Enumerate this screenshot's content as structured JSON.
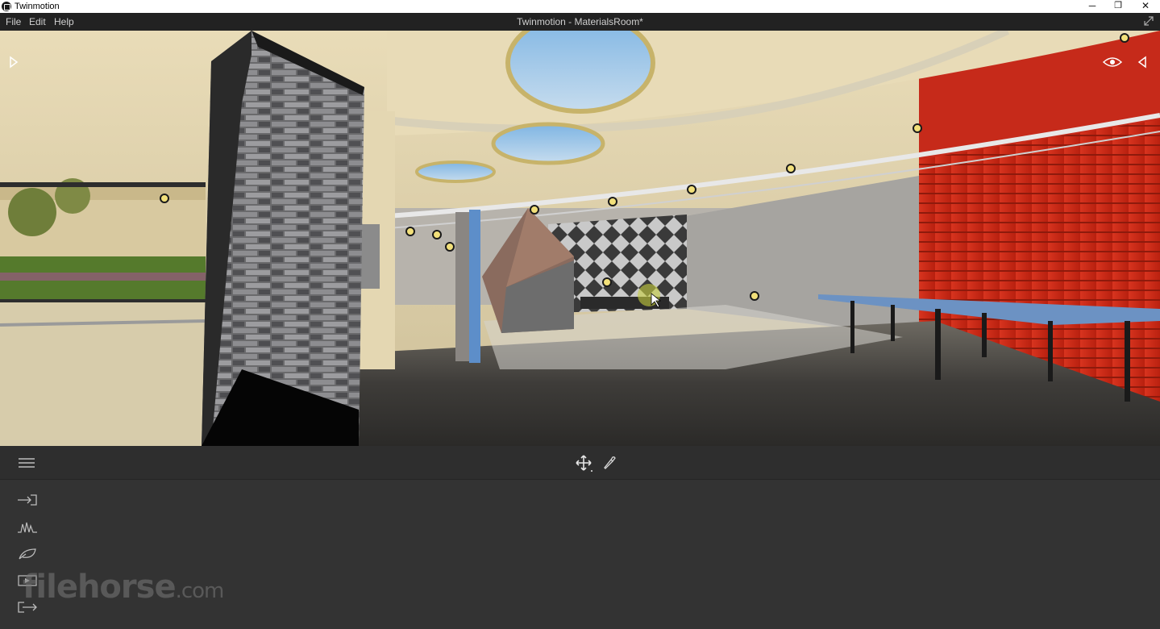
{
  "os_window": {
    "title": "Twinmotion",
    "minimize": "─",
    "maximize": "❐",
    "close": "✕"
  },
  "menubar": {
    "file": "File",
    "edit": "Edit",
    "help": "Help",
    "document_title": "Twinmotion - MaterialsRoom*"
  },
  "viewport": {
    "left_toggle_icon": "play-right-icon",
    "eye_icon": "eye-icon",
    "right_toggle_icon": "play-left-icon"
  },
  "toolbar": {
    "menu_icon": "hamburger-icon",
    "move_icon": "move-arrows-icon",
    "picker_icon": "eyedropper-icon"
  },
  "side_panel": {
    "icons": [
      "import-icon",
      "settings-wave-icon",
      "leaf-icon",
      "media-icon",
      "export-icon"
    ]
  },
  "watermark": {
    "text": "filehorse",
    "suffix": ".com"
  },
  "colors": {
    "titlebar": "#ffffff",
    "menubar": "#222222",
    "toolbar": "#2e2e2e",
    "panel": "#333333",
    "accent_red": "#c8281c"
  }
}
